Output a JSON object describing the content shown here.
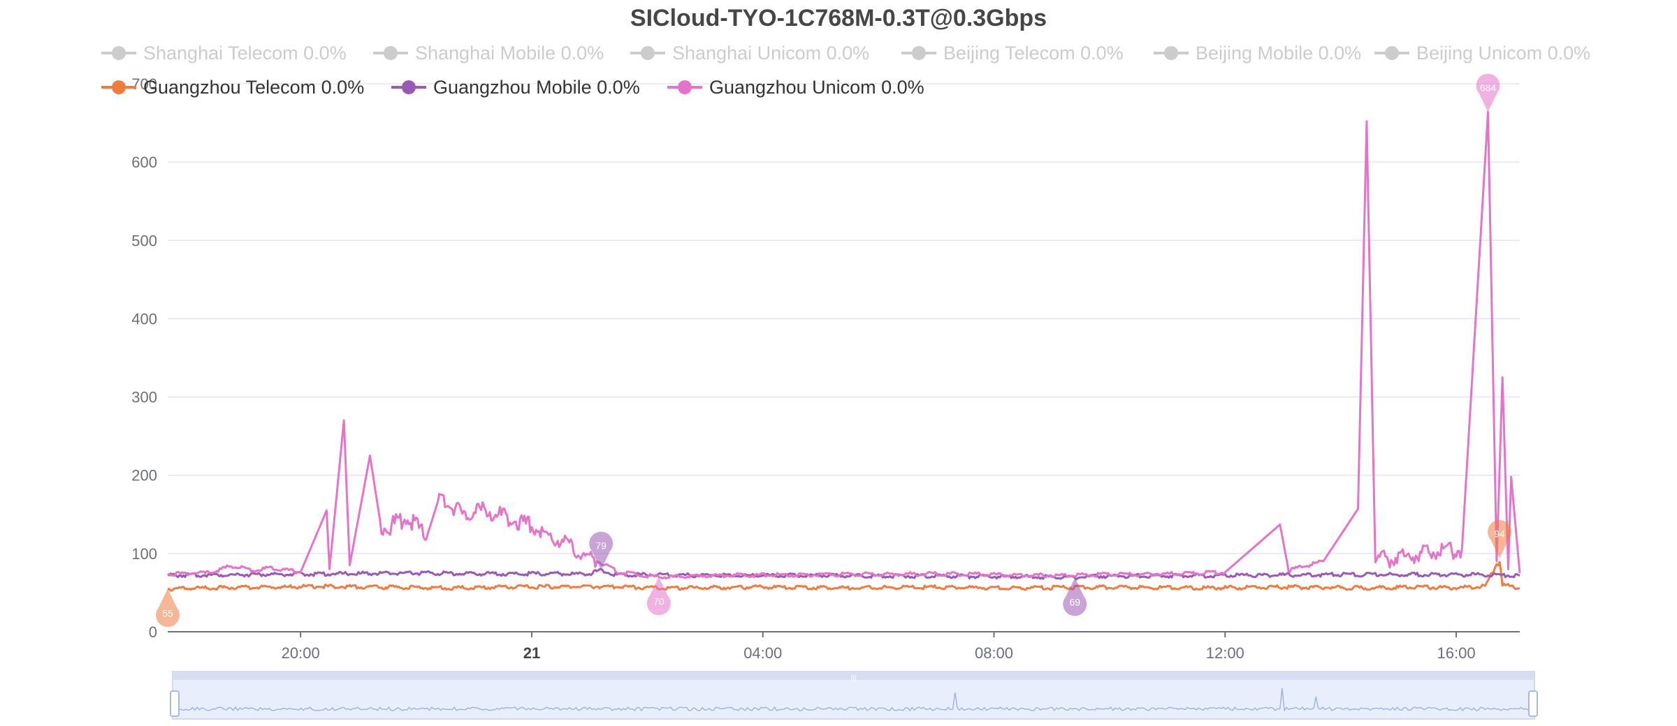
{
  "chart_data": {
    "type": "line",
    "title": "SICloud-TYO-1C768M-0.3T@0.3Gbps",
    "x_tick_labels": [
      "20:00",
      "21",
      "04:00",
      "08:00",
      "12:00",
      "16:00"
    ],
    "y_tick_labels": [
      "0",
      "100",
      "200",
      "300",
      "400",
      "500",
      "600",
      "700"
    ],
    "ylim": [
      0,
      700
    ],
    "grid": true,
    "legend_position": "top",
    "series": [
      {
        "name": "Shanghai Telecom 0.0%",
        "color": "#cccccc",
        "enabled": false,
        "values": []
      },
      {
        "name": "Shanghai Mobile 0.0%",
        "color": "#cccccc",
        "enabled": false,
        "values": []
      },
      {
        "name": "Shanghai Unicom 0.0%",
        "color": "#cccccc",
        "enabled": false,
        "values": []
      },
      {
        "name": "Beijing Telecom 0.0%",
        "color": "#cccccc",
        "enabled": false,
        "values": []
      },
      {
        "name": "Beijing Mobile 0.0%",
        "color": "#cccccc",
        "enabled": false,
        "values": []
      },
      {
        "name": "Beijing Unicom 0.0%",
        "color": "#cccccc",
        "enabled": false,
        "values": []
      },
      {
        "name": "Guangzhou Telecom 0.0%",
        "color": "#f07b3f",
        "enabled": true,
        "points": [
          [
            17.7,
            55
          ],
          [
            18.5,
            56
          ],
          [
            19.5,
            57
          ],
          [
            20.4,
            58
          ],
          [
            21.5,
            57
          ],
          [
            22.5,
            56
          ],
          [
            23.5,
            57
          ],
          [
            1.0,
            58
          ],
          [
            2.5,
            56
          ],
          [
            4.0,
            57
          ],
          [
            5.5,
            56
          ],
          [
            7.0,
            57
          ],
          [
            8.5,
            56
          ],
          [
            10.0,
            57
          ],
          [
            11.5,
            56
          ],
          [
            13.0,
            57
          ],
          [
            14.5,
            56
          ],
          [
            15.5,
            57
          ],
          [
            16.0,
            56
          ],
          [
            16.5,
            58
          ],
          [
            16.75,
            94
          ],
          [
            16.8,
            60
          ],
          [
            17.1,
            56
          ]
        ],
        "markers": [
          {
            "label": "55",
            "x": 17.7,
            "y": 55
          },
          {
            "label": "94",
            "x": 16.75,
            "y": 94
          }
        ]
      },
      {
        "name": "Guangzhou Mobile 0.0%",
        "color": "#9b59b6",
        "enabled": true,
        "points": [
          [
            17.7,
            72
          ],
          [
            19.0,
            73
          ],
          [
            20.5,
            74
          ],
          [
            22.0,
            75
          ],
          [
            23.5,
            74
          ],
          [
            1.0,
            74
          ],
          [
            1.2,
            79
          ],
          [
            1.4,
            73
          ],
          [
            3.0,
            72
          ],
          [
            5.0,
            72
          ],
          [
            7.0,
            71
          ],
          [
            9.0,
            70
          ],
          [
            9.4,
            69
          ],
          [
            9.8,
            71
          ],
          [
            12.0,
            72
          ],
          [
            14.0,
            73
          ],
          [
            16.0,
            73
          ],
          [
            17.1,
            72
          ]
        ],
        "markers": [
          {
            "label": "79",
            "x": 1.2,
            "y": 79
          },
          {
            "label": "69",
            "x": 9.4,
            "y": 69
          }
        ]
      },
      {
        "name": "Guangzhou Unicom 0.0%",
        "color": "#e573c9",
        "enabled": true,
        "points": [
          [
            17.7,
            74
          ],
          [
            18.4,
            75
          ],
          [
            18.8,
            84
          ],
          [
            19.2,
            78
          ],
          [
            19.5,
            82
          ],
          [
            20.0,
            76
          ],
          [
            20.45,
            155
          ],
          [
            20.5,
            80
          ],
          [
            20.75,
            270
          ],
          [
            20.85,
            85
          ],
          [
            21.2,
            225
          ],
          [
            21.4,
            130
          ],
          [
            21.8,
            145
          ],
          [
            22.2,
            125
          ],
          [
            22.4,
            172
          ],
          [
            22.8,
            150
          ],
          [
            23.2,
            155
          ],
          [
            23.6,
            145
          ],
          [
            0.0,
            135
          ],
          [
            0.4,
            120
          ],
          [
            0.8,
            100
          ],
          [
            1.2,
            88
          ],
          [
            1.5,
            76
          ],
          [
            2.2,
            70
          ],
          [
            3.5,
            72
          ],
          [
            5.0,
            73
          ],
          [
            7.0,
            74
          ],
          [
            9.0,
            72
          ],
          [
            11.0,
            74
          ],
          [
            12.0,
            76
          ],
          [
            12.95,
            137
          ],
          [
            13.1,
            78
          ],
          [
            13.7,
            90
          ],
          [
            14.3,
            157
          ],
          [
            14.45,
            652
          ],
          [
            14.6,
            90
          ],
          [
            15.0,
            95
          ],
          [
            15.7,
            103
          ],
          [
            16.1,
            106
          ],
          [
            16.55,
            664
          ],
          [
            16.7,
            90
          ],
          [
            16.8,
            325
          ],
          [
            16.9,
            80
          ],
          [
            16.95,
            198
          ],
          [
            17.1,
            75
          ]
        ],
        "markers": [
          {
            "label": "70",
            "x": 2.2,
            "y": 70
          },
          {
            "label": "684",
            "x": 16.55,
            "y": 664
          }
        ]
      }
    ]
  }
}
